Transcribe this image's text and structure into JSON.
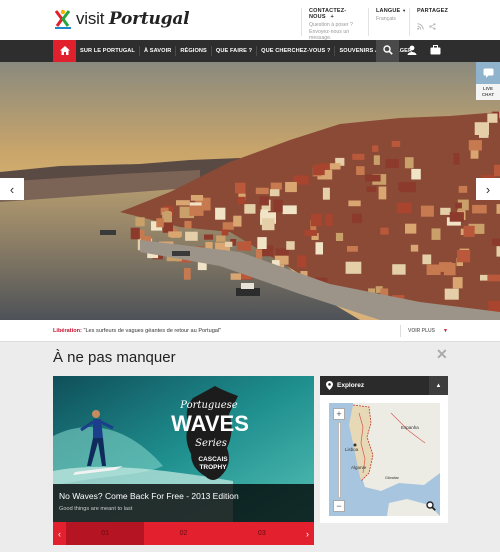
{
  "header": {
    "logo_text_plain": "visit ",
    "logo_text_bold": "Portugal",
    "contact": {
      "title": "CONTACTEZ-NOUS",
      "plus": "+",
      "line1": "Question à poser ?",
      "line2": "Envoyez-nous un",
      "line3": "message."
    },
    "language": {
      "title": "LANGUE",
      "value": "Français"
    },
    "share": {
      "title": "PARTAGEZ"
    }
  },
  "nav": {
    "items": [
      {
        "label": "SUR LE PORTUGAL"
      },
      {
        "label": "À SAVOIR"
      },
      {
        "label": "RÉGIONS"
      },
      {
        "label": "QUE FAIRE ?"
      },
      {
        "label": "QUE CHERCHEZ-VOUS ?"
      },
      {
        "label": "SOUVENIRS À PARTAGER"
      }
    ],
    "icons": [
      "home-icon",
      "search-icon",
      "user-icon",
      "briefcase-icon"
    ]
  },
  "hero": {
    "prev_icon": "chevron-left-icon",
    "next_icon": "chevron-right-icon"
  },
  "chat": {
    "line1": "LIVE",
    "line2": "CHAT"
  },
  "news": {
    "label": "Libération:",
    "text": " \"Les surfeurs de vagues géantes de retour au Portugal\"",
    "more": "VOIR PLUS"
  },
  "section": {
    "title": "À ne pas manquer"
  },
  "feature": {
    "badge_line1": "Portuguese",
    "badge_line2": "WAVES",
    "badge_line3": "Series",
    "badge_line4": "CASCAIS",
    "badge_line5": "TROPHY",
    "title": "No Waves? Come Back For Free - 2013 Edition",
    "subtitle": "Good things are meant to last",
    "pages": [
      "01",
      "02",
      "03"
    ],
    "active_page": 0
  },
  "explore": {
    "title": "Explorez",
    "map_labels": [
      "Espanha",
      "Lisboa",
      "Algarve",
      "Gibraltar"
    ],
    "zoom_in": "+",
    "zoom_out": "−"
  },
  "colors": {
    "brand_red": "#e0202c",
    "nav_dark": "#2e2e2e"
  }
}
